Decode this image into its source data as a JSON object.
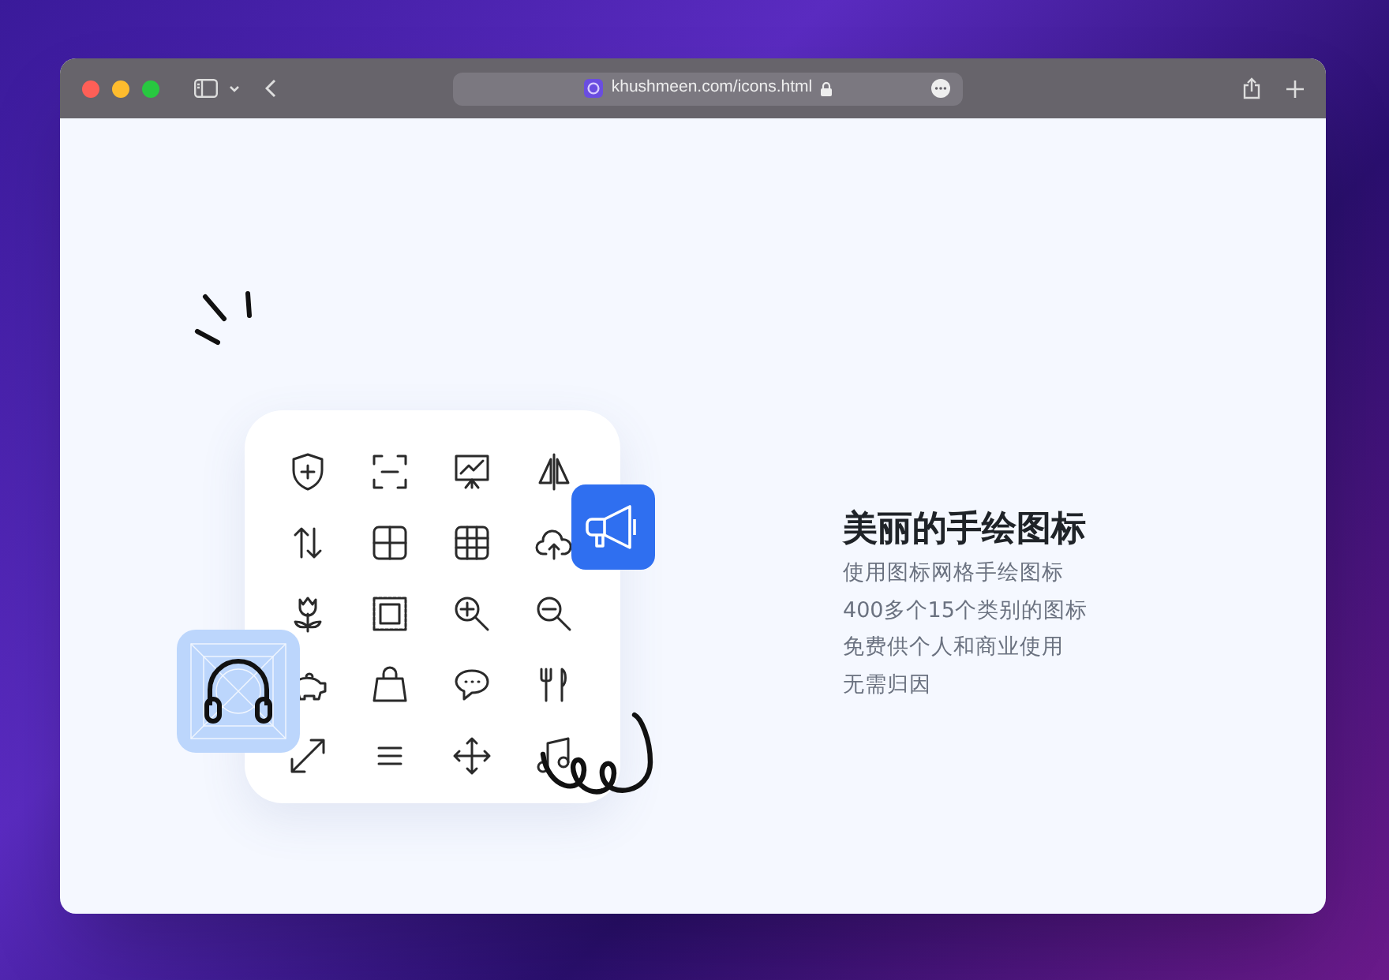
{
  "browser": {
    "url": "khushmeen.com/icons.html"
  },
  "hero": {
    "title": "美丽的手绘图标",
    "lines": [
      "使用图标网格手绘图标",
      "400多个15个类别的图标",
      "免费供个人和商业使用",
      "无需归因"
    ]
  }
}
